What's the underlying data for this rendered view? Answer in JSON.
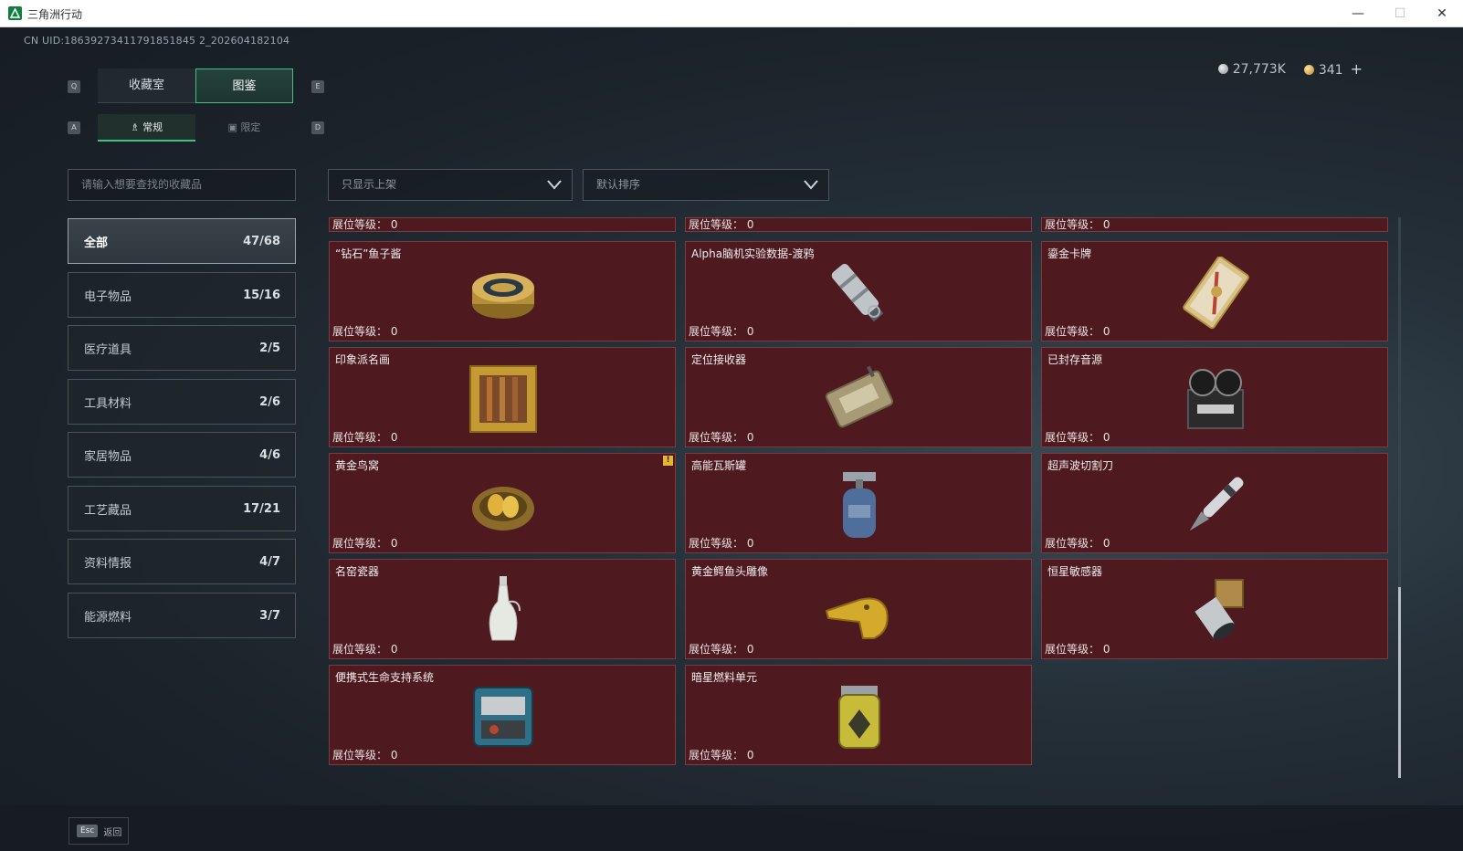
{
  "window": {
    "title": "三角洲行动",
    "minimize": "—",
    "maximize": "☐",
    "close": "✕"
  },
  "uid": "CN UID:18639273411791851845 2_202604182104",
  "currency": {
    "silver": "27,773K",
    "gold": "341",
    "add": "+"
  },
  "keys": {
    "q": "Q",
    "e": "E",
    "a": "A",
    "d": "D"
  },
  "tabs": [
    {
      "label": "收藏室"
    },
    {
      "label": "图鉴"
    }
  ],
  "subtabs": [
    {
      "label": "常规"
    },
    {
      "label": "限定"
    }
  ],
  "search": {
    "placeholder": "请输入想要查找的收藏品"
  },
  "filters": {
    "shelf": "只显示上架",
    "sort": "默认排序"
  },
  "categories": [
    {
      "label": "全部",
      "count": "47/68"
    },
    {
      "label": "电子物品",
      "count": "15/16"
    },
    {
      "label": "医疗道具",
      "count": "2/5"
    },
    {
      "label": "工具材料",
      "count": "2/6"
    },
    {
      "label": "家居物品",
      "count": "4/6"
    },
    {
      "label": "工艺藏品",
      "count": "17/21"
    },
    {
      "label": "资料情报",
      "count": "4/7"
    },
    {
      "label": "能源燃料",
      "count": "3/7"
    }
  ],
  "level_label": "展位等级： 0",
  "items": [
    {
      "name": "",
      "icon": "unknown-item-icon"
    },
    {
      "name": "",
      "icon": "unknown-item-icon"
    },
    {
      "name": "",
      "icon": "unknown-item-icon"
    },
    {
      "name": "“钻石”鱼子酱",
      "icon": "caviar-tin-icon"
    },
    {
      "name": "Alpha脑机实验数据-渡鸦",
      "icon": "data-capsule-icon"
    },
    {
      "name": "鎏金卡牌",
      "icon": "gilded-card-icon"
    },
    {
      "name": "印象派名画",
      "icon": "framed-painting-icon"
    },
    {
      "name": "定位接收器",
      "icon": "locator-receiver-icon"
    },
    {
      "name": "已封存音源",
      "icon": "reel-recorder-icon"
    },
    {
      "name": "黄金鸟窝",
      "icon": "golden-nest-icon",
      "warning": "!"
    },
    {
      "name": "高能瓦斯罐",
      "icon": "gas-canister-icon"
    },
    {
      "name": "超声波切割刀",
      "icon": "ultrasonic-cutter-icon"
    },
    {
      "name": "名窑瓷器",
      "icon": "porcelain-vase-icon"
    },
    {
      "name": "黄金鳄鱼头雕像",
      "icon": "gold-crocodile-statue-icon"
    },
    {
      "name": "恒星敏感器",
      "icon": "star-sensor-icon"
    },
    {
      "name": "便携式生命支持系统",
      "icon": "life-support-icon"
    },
    {
      "name": "暗星燃料单元",
      "icon": "fuel-cell-icon"
    }
  ],
  "footer": {
    "esc_key": "Esc",
    "back": "返回"
  },
  "colors": {
    "accent": "#3fbf8a",
    "card_bg": "#4f1a1f",
    "warning": "#e8b52f"
  }
}
